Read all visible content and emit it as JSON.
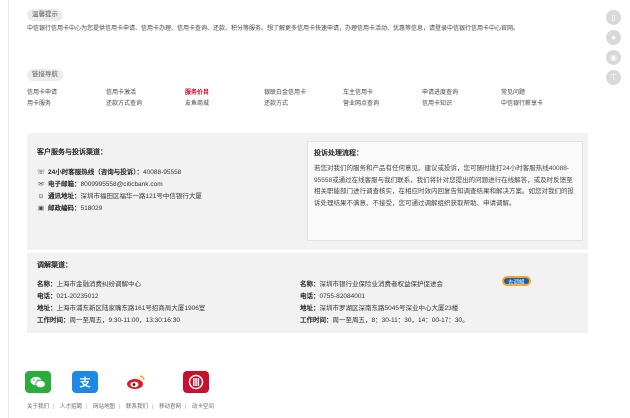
{
  "notice": {
    "label": "温馨提示",
    "text": "中信银行信用卡中心为您提供信用卡申请、信用卡办理、信用卡查询、还款、积分等服务。想了解更多信用卡快速申请，办理信用卡活动、优惠等信息，请登录中信银行信用卡中心官网。"
  },
  "nav": {
    "label": "链接导航",
    "items": [
      "信用卡申请",
      "信用卡激活",
      "服务价目",
      "银联白金信用卡",
      "车主信用卡",
      "申请进度查询",
      "常见问题",
      "用卡服务",
      "还款方式查询",
      "友鱼商城",
      "还款方式",
      "营业网点查询",
      "信用卡知识",
      "中信银行薪享卡"
    ]
  },
  "service": {
    "title": "客户服务与投诉渠道：",
    "hotline_label": "24小时客服热线（咨询与投诉）：",
    "hotline": "40088-95558",
    "email_label": "电子邮箱：",
    "email": "8009995558@citicbank.com",
    "address_label": "通讯地址：",
    "address": "深圳市福田区福华一路121号中信银行大厦",
    "zip_label": "邮政编码：",
    "zip": "518029"
  },
  "complaint": {
    "title": "投诉处理流程：",
    "text": "若您对我们的服务和产品有任何意见、建议或投诉，您可随时拨打24小时客服热线40088-95558或通过在线客服与我们联系，我们将针对您提出的问题进行在线解答，或及时反馈至相关职能部门进行调查核实，在相应时效内回复告知调查结果和解决方案。如您对我们的投诉处理结果不满意、不接受，您可通过调解组织获取帮助、申请调解。"
  },
  "mediation": {
    "title": "调解渠道：",
    "left": {
      "name_label": "名称：",
      "name": "上海市金融消费纠纷调解中心",
      "phone_label": "电话：",
      "phone": "021-20235012",
      "addr_label": "地址：",
      "addr": "上海市浦东新区陆家嘴东路161号招商局大厦1906室",
      "hours_label": "工作时间：",
      "hours": "周一至周五，9:30-11:00，13:30:16:30"
    },
    "right": {
      "name_label": "名称：",
      "name": "深圳市银行业保险业消费者权益保护促进会",
      "button": "去调解",
      "phone_label": "电话：",
      "phone": "0755-82084001",
      "addr_label": "地址：",
      "addr": "深圳市罗湖区深南东路5045号深业中心大厦23楼",
      "hours_label": "工作时间：",
      "hours": "周一至周五，8：30-11：30，14：00-17：30。"
    }
  },
  "footer": [
    "关于我们",
    "人才招聘",
    "网站地图",
    "联系我们",
    "移动官网",
    "动卡空间"
  ],
  "colors": {
    "accent": "#c8102e",
    "button": "#1a5fb4",
    "button_border": "#f5a623"
  }
}
